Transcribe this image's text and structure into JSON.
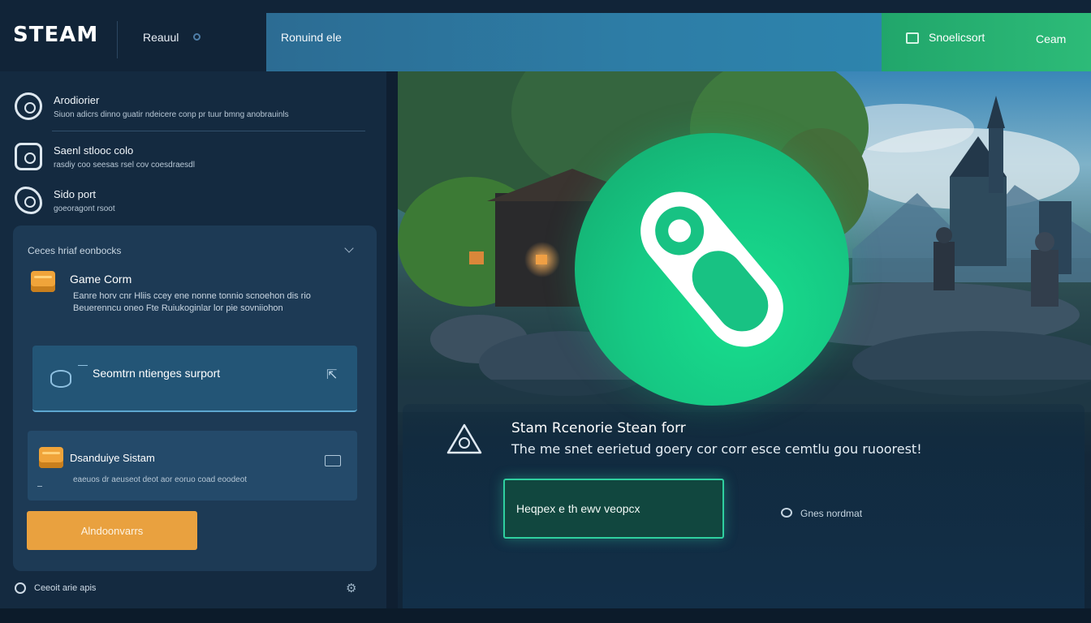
{
  "header": {
    "logo": "STEAM",
    "nav_first": "Reauul",
    "nav_active": "Ronuind ele",
    "nav_green_label": "Snoelicsort",
    "nav_green_right": "Ceam"
  },
  "sidebar": {
    "items": [
      {
        "title": "Arodiorier",
        "sub": "Siuon adicrs dinno guatir ndeicere conp pr tuur bmng anobrauinls",
        "icon": "headset-icon"
      },
      {
        "title": "Saenl stlooc colo",
        "sub": "rasdiy coo seesas rsel cov coesdraesdl",
        "icon": "chat-icon"
      },
      {
        "title": "Sido port",
        "sub": "goeoragont rsoot",
        "icon": "phone-icon"
      }
    ]
  },
  "panel": {
    "header": "Ceces hriaf eonbocks",
    "game_center_title": "Game Corm",
    "game_center_desc": "Eanre horv cnr Hliis ccey ene nonne tonnio scnoehon dis rio Beuerenncu oneo Fte Ruiukoginlar lor pie sovniiohon",
    "card1_label": "Seomtrn ntienges surport",
    "card2_label": "Dsanduiye Sistam",
    "card2_sub": "eaeuos dr aeuseot deot aor eoruo coad eoodeot",
    "orange_button": "Alndoonvarrs"
  },
  "footer": {
    "label": "Ceeoit arie apis"
  },
  "hero": {
    "support_title": "Stam Rcenorie Stean forr",
    "support_desc": "The me snet eerietud goery cor corr esce cemtlu gou ruoorest!",
    "cta_button": "Heqpex e th ewv veopcx",
    "status_label": "Gnes nordmat"
  },
  "colors": {
    "brand_green": "#16c984",
    "accent_blue": "#2d7da6",
    "accent_orange": "#e9a13f",
    "background": "#0f1f31"
  }
}
